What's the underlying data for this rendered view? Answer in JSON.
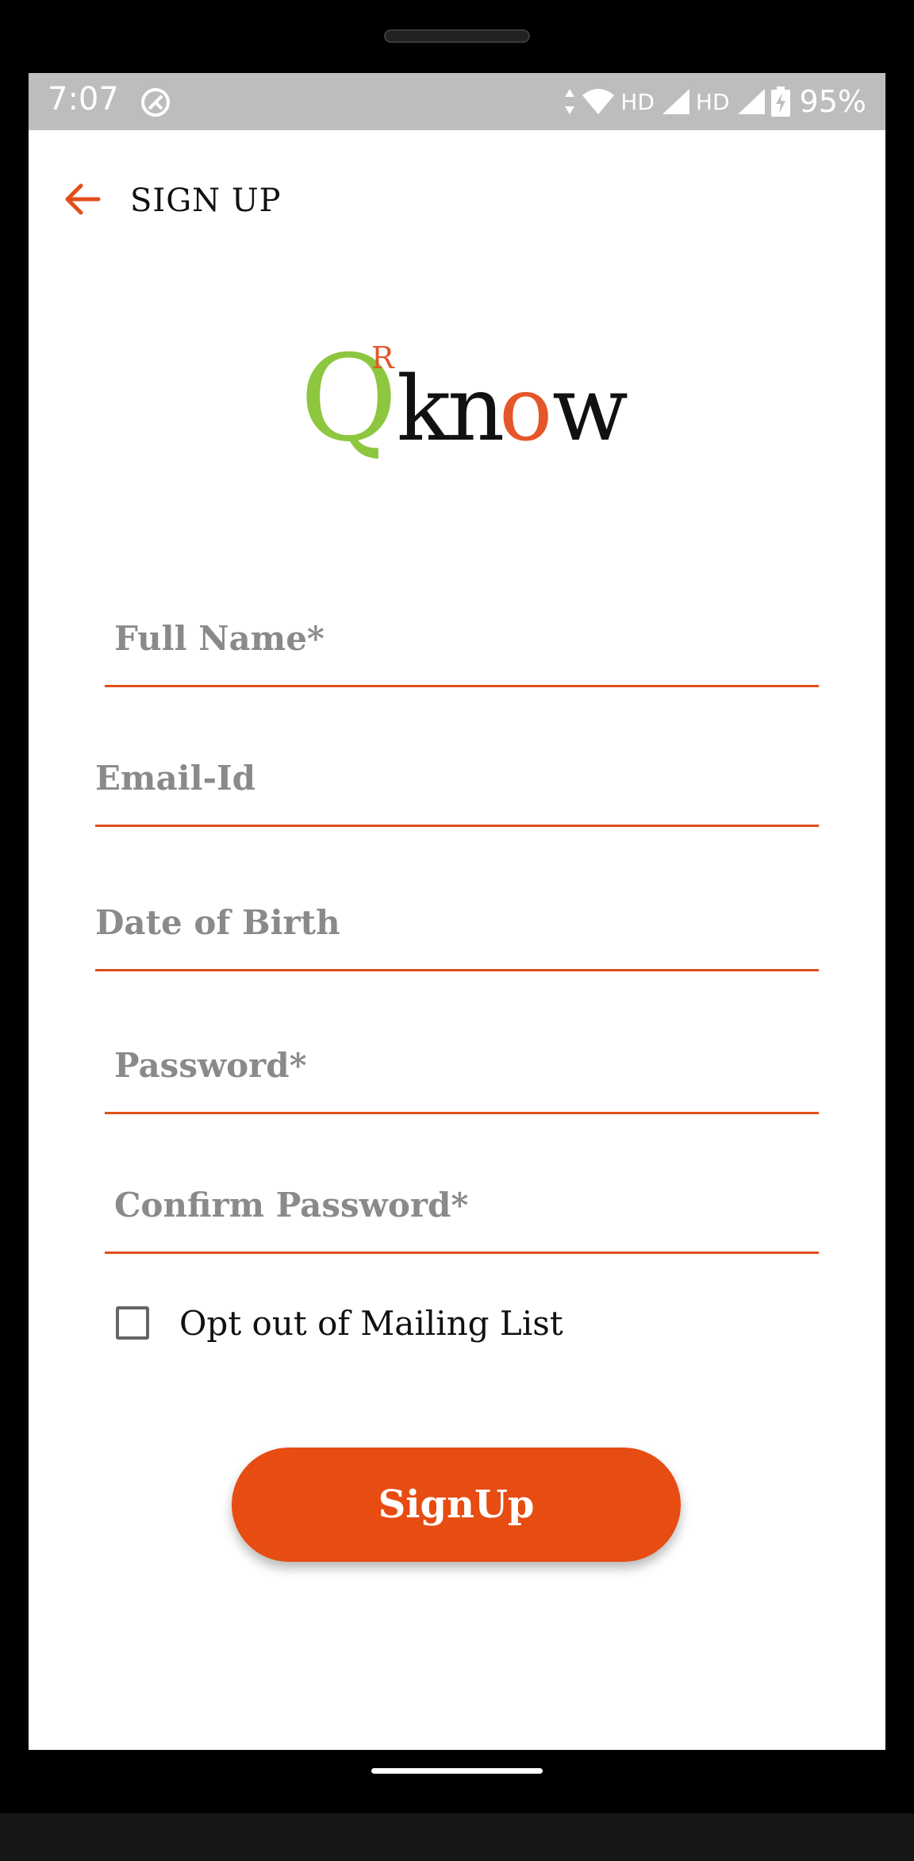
{
  "status_bar": {
    "time": "7:07",
    "network_1": "HD",
    "network_2": "HD",
    "battery": "95%",
    "icons": [
      "app-notification-icon",
      "data-arrows-icon",
      "wifi-icon",
      "signal-icon",
      "signal-icon",
      "battery-charging-icon"
    ]
  },
  "header": {
    "title": "SIGN UP",
    "back_icon": "arrow-left-icon"
  },
  "logo": {
    "q": "Q",
    "r": "R",
    "k": "k",
    "n": "n",
    "o": "o",
    "w": "w",
    "colors": {
      "green": "#8dc63f",
      "orange": "#e5572a",
      "black": "#111111"
    }
  },
  "form": {
    "full_name_placeholder": "Full Name*",
    "email_placeholder": "Email-Id",
    "dob_placeholder": "Date of Birth",
    "password_placeholder": "Password*",
    "confirm_password_placeholder": "Confirm Password*",
    "optout_label": "Opt out of Mailing List",
    "optout_checked": false,
    "submit_label": "SignUp"
  },
  "colors": {
    "accent": "#e74c12",
    "underline": "#e24e1b",
    "status_bar": "#bdbdbd"
  }
}
